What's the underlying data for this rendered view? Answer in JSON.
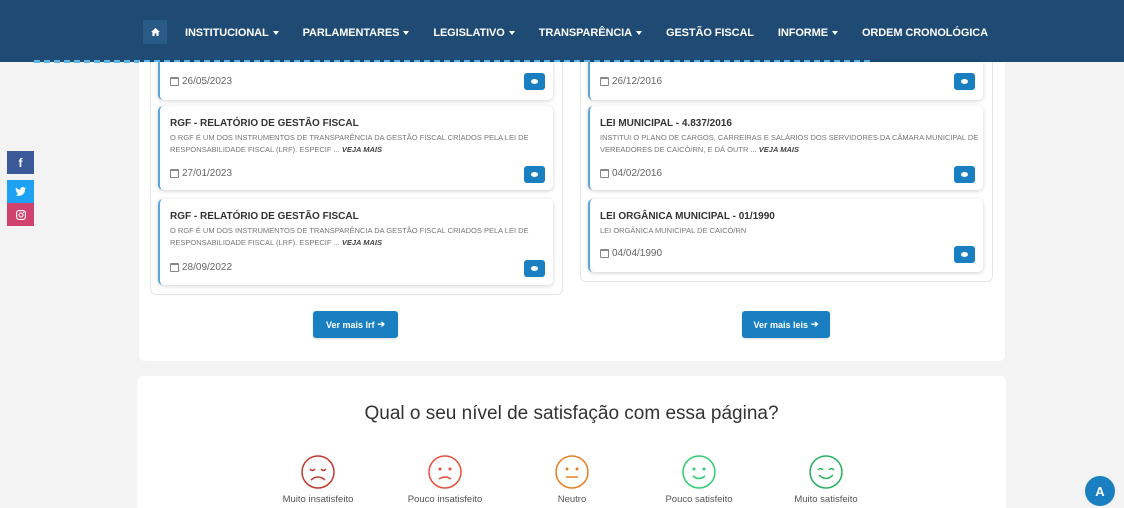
{
  "nav": {
    "items": [
      {
        "label": "INSTITUCIONAL",
        "dropdown": true
      },
      {
        "label": "PARLAMENTARES",
        "dropdown": true
      },
      {
        "label": "LEGISLATIVO",
        "dropdown": true
      },
      {
        "label": "TRANSPARÊNCIA",
        "dropdown": true
      },
      {
        "label": "GESTÃO FISCAL",
        "dropdown": false
      },
      {
        "label": "INFORME",
        "dropdown": true
      },
      {
        "label": "ORDEM CRONOLÓGICA",
        "dropdown": false
      }
    ]
  },
  "social": {
    "facebook": "f",
    "twitter": "t",
    "instagram": "ig"
  },
  "lrf": {
    "first_date": "26/05/2023",
    "cards": [
      {
        "title": "RGF - RELATÓRIO DE GESTÃO FISCAL",
        "desc": "O RGF É UM DOS INSTRUMENTOS DE TRANSPARÊNCIA DA GESTÃO FISCAL CRIADOS PELA LEI DE RESPONSABILIDADE FISCAL (LRF). ESPECIF ...",
        "more": "VEJA MAIS",
        "date": "27/01/2023"
      },
      {
        "title": "RGF - RELATÓRIO DE GESTÃO FISCAL",
        "desc": "O RGF É UM DOS INSTRUMENTOS DE TRANSPARÊNCIA DA GESTÃO FISCAL CRIADOS PELA LEI DE RESPONSABILIDADE FISCAL (LRF). ESPECIF ...",
        "more": "VEJA MAIS",
        "date": "28/09/2022"
      }
    ],
    "button": "Ver mais lrf"
  },
  "leis": {
    "first_date": "26/12/2016",
    "cards": [
      {
        "title": "LEI MUNICIPAL - 4.837/2016",
        "desc": "INSTITUI O PLANO DE CARGOS, CARREIRAS E SALÁRIOS DOS SERVIDORES DA CÂMARA MUNICIPAL DE VEREADORES DE CAICÓ/RN, E DÁ OUTR ...",
        "more": "VEJA MAIS",
        "date": "04/02/2016"
      },
      {
        "title": "LEI ORGÂNICA MUNICIPAL - 01/1990",
        "desc": "LEI ORGÂNICA MUNICIPAL DE CAICÓ/RN",
        "more": "",
        "date": "04/04/1990"
      }
    ],
    "button": "Ver mais leis"
  },
  "satisfaction": {
    "title": "Qual o seu nível de satisfação com essa página?",
    "options": [
      {
        "label": "Muito insatisfeito",
        "color": "#c0392b"
      },
      {
        "label": "Pouco insatisfeito",
        "color": "#e74c3c"
      },
      {
        "label": "Neutro",
        "color": "#e67e22"
      },
      {
        "label": "Pouco satisfeito",
        "color": "#2ecc71"
      },
      {
        "label": "Muito satisfeito",
        "color": "#27ae60"
      }
    ]
  },
  "fab_label": "A"
}
